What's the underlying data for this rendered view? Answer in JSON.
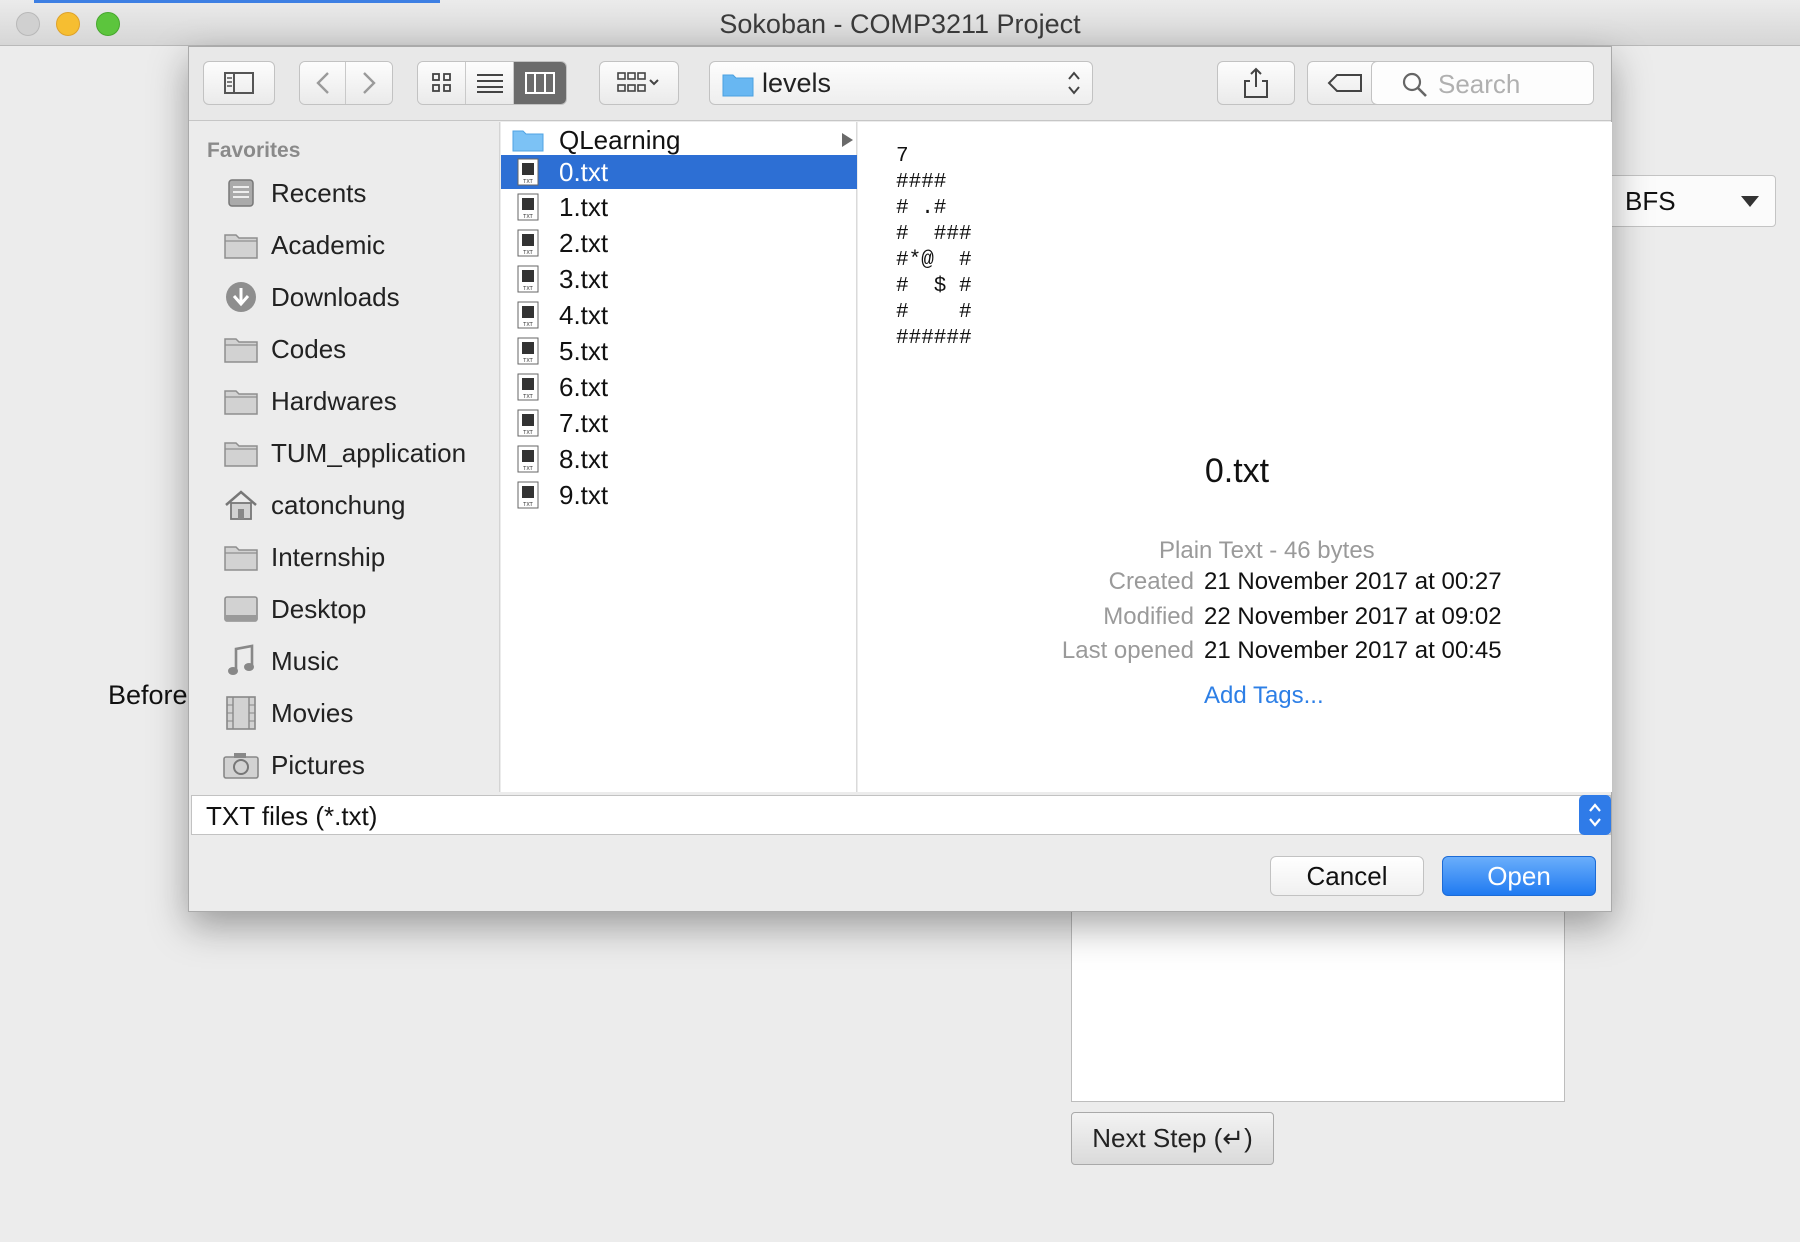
{
  "window": {
    "title": "Sokoban - COMP3211 Project"
  },
  "background": {
    "algorithm_select": "BFS",
    "before_label": "Before",
    "next_step_button": "Next Step (↵)"
  },
  "dialog": {
    "location": "levels",
    "search_placeholder": "Search",
    "sidebar": {
      "heading": "Favorites",
      "items": [
        {
          "label": "Recents",
          "icon": "recents-icon"
        },
        {
          "label": "Academic",
          "icon": "folder-icon"
        },
        {
          "label": "Downloads",
          "icon": "downloads-icon"
        },
        {
          "label": "Codes",
          "icon": "folder-icon"
        },
        {
          "label": "Hardwares",
          "icon": "folder-icon"
        },
        {
          "label": "TUM_application",
          "icon": "folder-icon"
        },
        {
          "label": "catonchung",
          "icon": "home-icon"
        },
        {
          "label": "Internship",
          "icon": "folder-icon"
        },
        {
          "label": "Desktop",
          "icon": "desktop-icon"
        },
        {
          "label": "Music",
          "icon": "music-icon"
        },
        {
          "label": "Movies",
          "icon": "movies-icon"
        },
        {
          "label": "Pictures",
          "icon": "camera-icon"
        }
      ]
    },
    "files": [
      {
        "name": "QLearning",
        "type": "folder"
      },
      {
        "name": "0.txt",
        "type": "txt",
        "selected": true
      },
      {
        "name": "1.txt",
        "type": "txt"
      },
      {
        "name": "2.txt",
        "type": "txt"
      },
      {
        "name": "3.txt",
        "type": "txt"
      },
      {
        "name": "4.txt",
        "type": "txt"
      },
      {
        "name": "5.txt",
        "type": "txt"
      },
      {
        "name": "6.txt",
        "type": "txt"
      },
      {
        "name": "7.txt",
        "type": "txt"
      },
      {
        "name": "8.txt",
        "type": "txt"
      },
      {
        "name": "9.txt",
        "type": "txt"
      }
    ],
    "preview": {
      "content": "7\n####\n# .#\n#  ###\n#*@  #\n#  $ #\n#    #\n######",
      "filename": "0.txt",
      "kind": "Plain Text - 46 bytes",
      "meta": [
        {
          "key": "Created",
          "value": "21 November 2017 at 00:27"
        },
        {
          "key": "Modified",
          "value": "22 November 2017 at 09:02"
        },
        {
          "key": "Last opened",
          "value": "21 November 2017 at 00:45"
        }
      ],
      "add_tags": "Add Tags..."
    },
    "filter": "TXT files (*.txt)",
    "cancel_label": "Cancel",
    "open_label": "Open"
  },
  "colors": {
    "accent": "#2f7be8",
    "selection": "#2d6fd4",
    "link": "#2d7fe6"
  }
}
